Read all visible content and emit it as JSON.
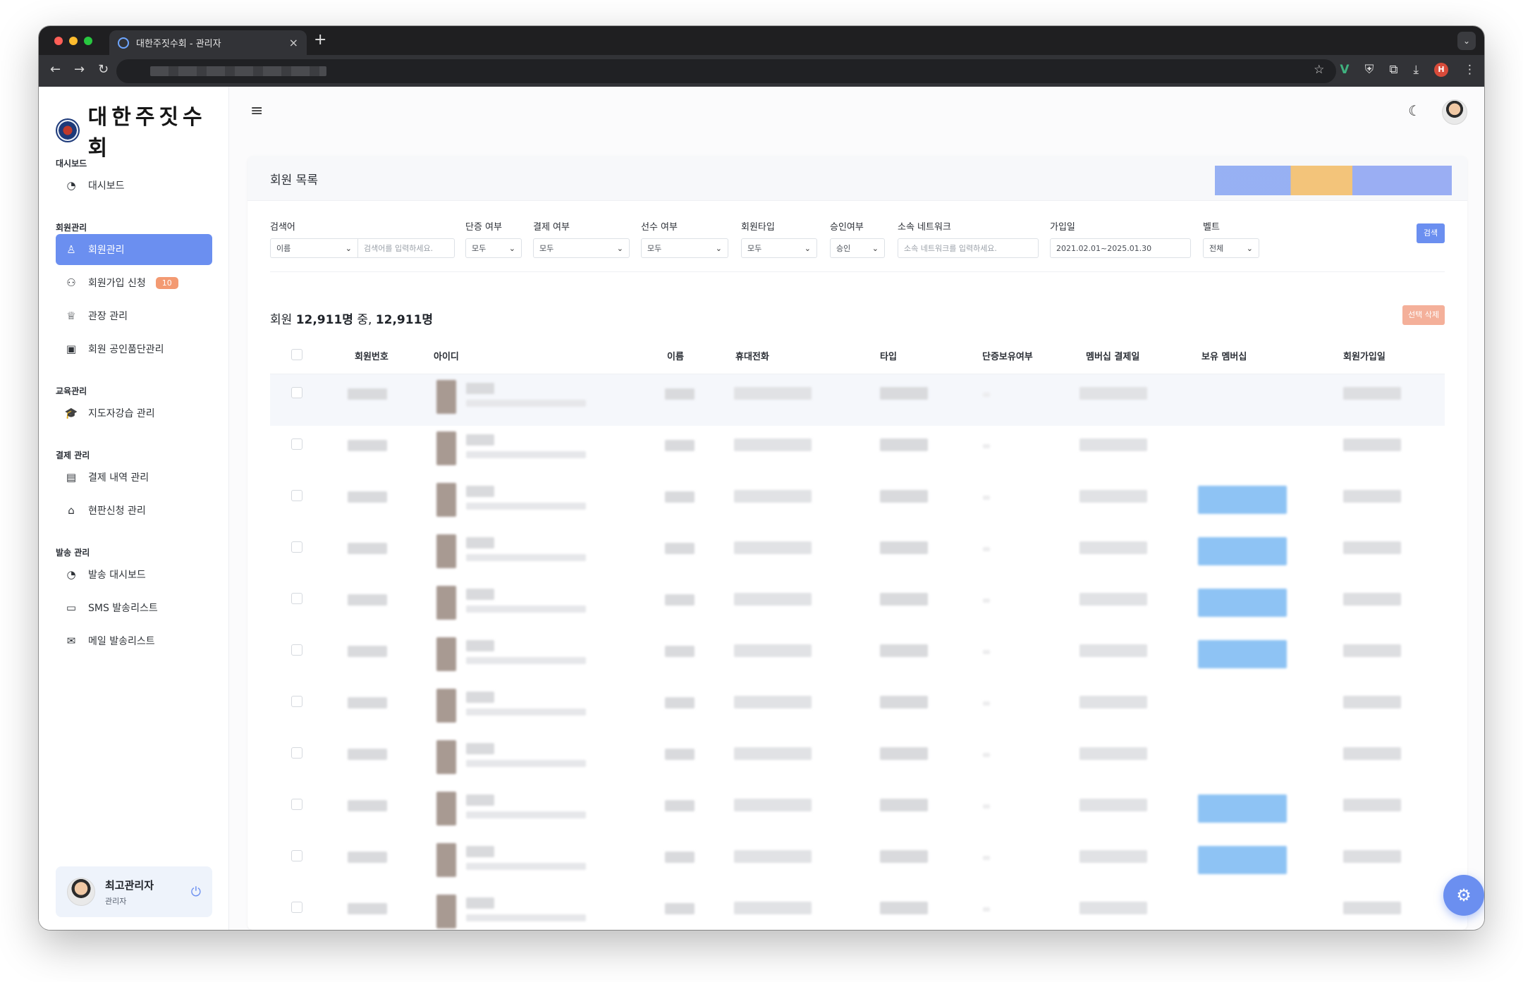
{
  "browser": {
    "tab_title": "대한주짓수회 - 관리자",
    "new_tab": "+",
    "tab_menu": "⌄"
  },
  "brand": {
    "name": "대한주짓수회"
  },
  "sidebar": {
    "sections": [
      {
        "title": "대시보드",
        "items": [
          {
            "label": "대시보드",
            "icon": "gauge-icon"
          }
        ]
      },
      {
        "title": "회원관리",
        "items": [
          {
            "label": "회원관리",
            "icon": "user-icon",
            "active": true
          },
          {
            "label": "회원가입 신청",
            "icon": "user-plus-icon",
            "badge": "10"
          },
          {
            "label": "관장 관리",
            "icon": "crown-icon"
          },
          {
            "label": "회원 공인품단관리",
            "icon": "certificate-icon"
          }
        ]
      },
      {
        "title": "교육관리",
        "items": [
          {
            "label": "지도자강습 관리",
            "icon": "graduation-cap-icon"
          }
        ]
      },
      {
        "title": "결제 관리",
        "items": [
          {
            "label": "결제 내역 관리",
            "icon": "receipt-icon"
          },
          {
            "label": "현판신청 관리",
            "icon": "store-icon"
          }
        ]
      },
      {
        "title": "발송 관리",
        "items": [
          {
            "label": "발송 대시보드",
            "icon": "gauge-icon"
          },
          {
            "label": "SMS 발송리스트",
            "icon": "message-icon"
          },
          {
            "label": "메일 발송리스트",
            "icon": "mail-icon"
          }
        ]
      }
    ],
    "user": {
      "name": "최고관리자",
      "role": "관리자"
    }
  },
  "page": {
    "title": "회원 목록",
    "filters": {
      "search_label": "검색어",
      "search_type": "이름",
      "search_placeholder": "검색어를 입력하세요.",
      "dan_label": "단증 여부",
      "dan_value": "모두",
      "pay_label": "결제 여부",
      "pay_value": "모두",
      "player_label": "선수 여부",
      "player_value": "모두",
      "type_label": "회원타입",
      "type_value": "모두",
      "approve_label": "승인여부",
      "approve_value": "승인",
      "network_label": "소속 네트워크",
      "network_placeholder": "소속 네트워크를 입력하세요.",
      "joined_label": "가입일",
      "joined_value": "2021.02.01~2025.01.30",
      "belt_label": "벨트",
      "belt_value": "전체",
      "search_button": "검색"
    },
    "count_prefix": "회원",
    "count_total": "12,911명",
    "count_mid": "중,",
    "count_shown": "12,911명",
    "delete_button": "선택 삭제",
    "columns": [
      "회원번호",
      "아이디",
      "이름",
      "휴대전화",
      "타입",
      "단증보유여부",
      "멤버십 결제일",
      "보유 멤버십",
      "회원가입일"
    ],
    "rows": [
      {
        "membership": false,
        "highlight": true
      },
      {
        "membership": false
      },
      {
        "membership": true
      },
      {
        "membership": true
      },
      {
        "membership": true
      },
      {
        "membership": true
      },
      {
        "membership": false
      },
      {
        "membership": false
      },
      {
        "membership": true
      },
      {
        "membership": true
      },
      {
        "membership": false
      }
    ]
  },
  "colors": {
    "accent": "#6b8ff0",
    "badge": "#f39a72",
    "danger_light": "#f4b09a",
    "membership": "#8ec3f4"
  }
}
